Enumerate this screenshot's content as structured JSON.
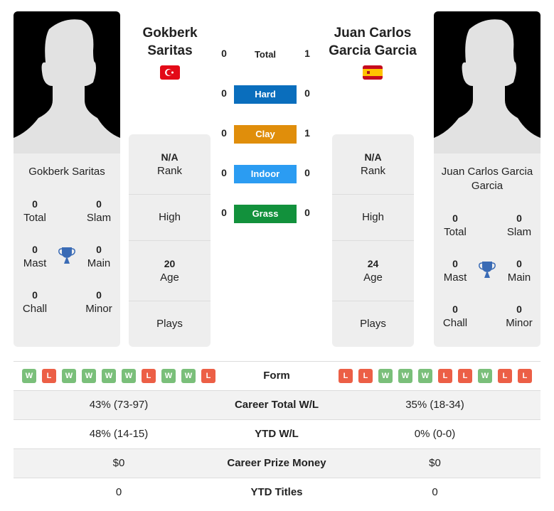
{
  "player1": {
    "name": "Gokberk Saritas",
    "name_line1": "Gokberk",
    "name_line2": "Saritas",
    "flag": "turkey-flag",
    "titles": {
      "total": "0",
      "total_label": "Total",
      "slam": "0",
      "slam_label": "Slam",
      "mast": "0",
      "mast_label": "Mast",
      "main": "0",
      "main_label": "Main",
      "chall": "0",
      "chall_label": "Chall",
      "minor": "0",
      "minor_label": "Minor"
    },
    "rank": "N/A",
    "rank_label": "Rank",
    "high_label": "High",
    "age": "20",
    "age_label": "Age",
    "plays_label": "Plays",
    "form": [
      "W",
      "L",
      "W",
      "W",
      "W",
      "W",
      "L",
      "W",
      "W",
      "L"
    ]
  },
  "player2": {
    "name": "Juan Carlos Garcia Garcia",
    "name_line1": "Juan Carlos",
    "name_line2": "Garcia Garcia",
    "card_line1": "Juan Carlos Garcia",
    "card_line2": "Garcia",
    "flag": "spain-flag",
    "titles": {
      "total": "0",
      "total_label": "Total",
      "slam": "0",
      "slam_label": "Slam",
      "mast": "0",
      "mast_label": "Mast",
      "main": "0",
      "main_label": "Main",
      "chall": "0",
      "chall_label": "Chall",
      "minor": "0",
      "minor_label": "Minor"
    },
    "rank": "N/A",
    "rank_label": "Rank",
    "high_label": "High",
    "age": "24",
    "age_label": "Age",
    "plays_label": "Plays",
    "form": [
      "L",
      "L",
      "W",
      "W",
      "W",
      "L",
      "L",
      "W",
      "L",
      "L"
    ]
  },
  "h2h": [
    {
      "label": "Total",
      "p1": "0",
      "p2": "1",
      "color": ""
    },
    {
      "label": "Hard",
      "p1": "0",
      "p2": "0",
      "color": "#0a6ebd"
    },
    {
      "label": "Clay",
      "p1": "0",
      "p2": "1",
      "color": "#e08e0b"
    },
    {
      "label": "Indoor",
      "p1": "0",
      "p2": "0",
      "color": "#2b9cf2"
    },
    {
      "label": "Grass",
      "p1": "0",
      "p2": "0",
      "color": "#12913c"
    }
  ],
  "colors": {
    "win": "#7abf7a",
    "loss": "#ec5f46",
    "trophy": "#3a6bb5"
  },
  "stats": {
    "form_label": "Form",
    "rows": [
      {
        "label": "Career Total W/L",
        "p1": "43% (73-97)",
        "p2": "35% (18-34)"
      },
      {
        "label": "YTD W/L",
        "p1": "48% (14-15)",
        "p2": "0% (0-0)"
      },
      {
        "label": "Career Prize Money",
        "p1": "$0",
        "p2": "$0"
      },
      {
        "label": "YTD Titles",
        "p1": "0",
        "p2": "0"
      }
    ]
  }
}
